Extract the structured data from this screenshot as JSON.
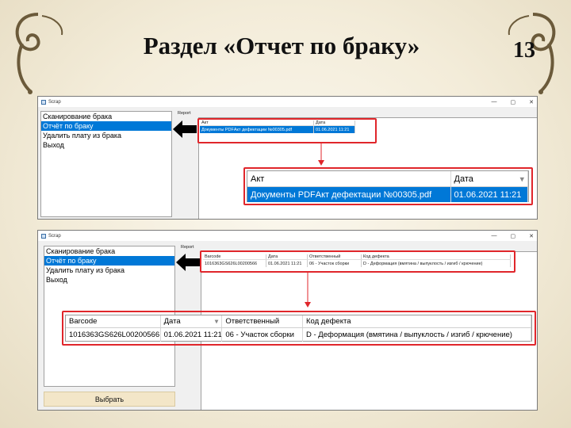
{
  "slide": {
    "title": "Раздел «Отчет по браку»",
    "page_number": "13"
  },
  "app": {
    "window_title": "Scrap",
    "menu_items": [
      "Сканирование брака",
      "Отчёт по браку",
      "Удалить плату из брака",
      "Выход"
    ],
    "selected_menu_index": 1,
    "report_label": "Report",
    "window_buttons": [
      "—",
      "▢",
      "✕"
    ]
  },
  "act_grid": {
    "columns": [
      "Акт",
      "Дата"
    ],
    "rows": [
      [
        "Документы PDFАкт дефектации №00305.pdf",
        "01.06.2021 11:21"
      ]
    ]
  },
  "defect_grid": {
    "columns": [
      "Barcode",
      "Дата",
      "Ответственный",
      "Код дефекта"
    ],
    "rows": [
      [
        "1016363GS626L00200566",
        "01.06.2021 11:21",
        "06 - Участок сборки",
        "D - Деформация (вмятина / выпуклость / изгиб / крючение)"
      ]
    ]
  },
  "select_button_label": "Выбрать",
  "colors": {
    "selection_blue": "#0078d7",
    "highlight_red": "#e0262b",
    "select_button_bg": "#f3e6c8"
  }
}
